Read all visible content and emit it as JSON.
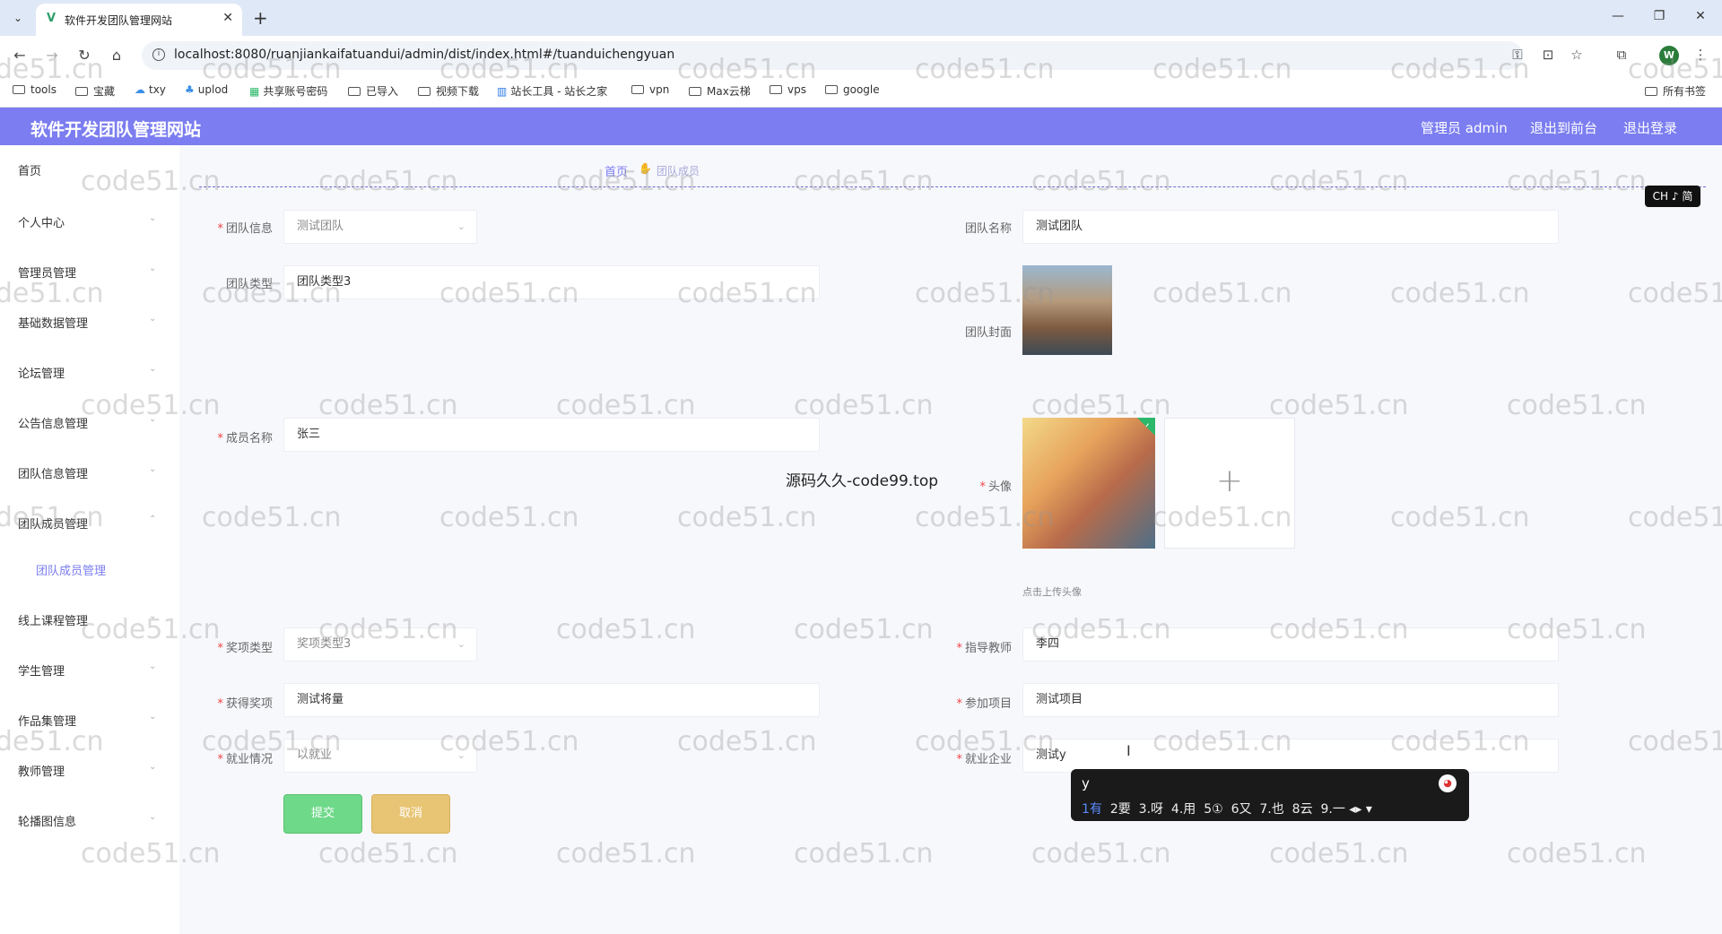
{
  "browser": {
    "tab_title": "软件开发团队管理网站",
    "url": "localhost:8080/ruanjiankaifatuandui/admin/dist/index.html#/tuanduichengyuan",
    "bookmarks": [
      "tools",
      "宝藏",
      "txy",
      "uplod",
      "共享账号密码",
      "已导入",
      "视频下载",
      "站长工具 - 站长之家",
      "vpn",
      "Max云梯",
      "vps",
      "google"
    ],
    "all_bookmarks": "所有书签",
    "profile_initial": "W"
  },
  "header": {
    "title": "软件开发团队管理网站",
    "admin_label": "管理员 admin",
    "to_front": "退出到前台",
    "logout": "退出登录",
    "accent": "#7b7df0"
  },
  "sidebar": {
    "items": [
      "首页",
      "个人中心",
      "管理员管理",
      "基础数据管理",
      "论坛管理",
      "公告信息管理",
      "团队信息管理",
      "团队成员管理",
      "线上课程管理",
      "学生管理",
      "作品集管理",
      "教师管理",
      "轮播图信息"
    ],
    "sub_item": "团队成员管理"
  },
  "breadcrumb": {
    "home": "首页",
    "current": "团队成员"
  },
  "ime_badge": "CH ♪ 简",
  "form": {
    "team_info_label": "团队信息",
    "team_info_value": "测试团队",
    "team_name_label": "团队名称",
    "team_name_value": "测试团队",
    "team_type_label": "团队类型",
    "team_type_value": "团队类型3",
    "cover_label": "团队封面",
    "member_name_label": "成员名称",
    "member_name_value": "张三",
    "avatar_label": "头像",
    "avatar_hint": "点击上传头像",
    "award_type_label": "奖项类型",
    "award_type_value": "奖项类型3",
    "teacher_label": "指导教师",
    "teacher_value": "李四",
    "award_label": "获得奖项",
    "award_value": "测试将量",
    "project_label": "参加项目",
    "project_value": "测试项目",
    "employment_label": "就业情况",
    "employment_value": "以就业",
    "company_label": "就业企业",
    "company_value": "测试y",
    "submit": "提交",
    "cancel": "取消"
  },
  "overlay_text": "源码久久-code99.top",
  "ime": {
    "input": "y",
    "candidates": [
      "1有",
      "2要",
      "3.呀",
      "4.用",
      "5①",
      "6又",
      "7.也",
      "8云",
      "9.一"
    ]
  },
  "watermark": "code51.cn"
}
